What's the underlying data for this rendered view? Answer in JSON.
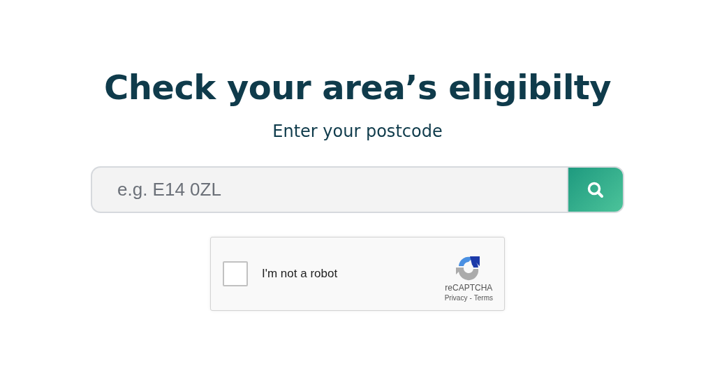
{
  "heading": "Check your area’s eligibilty",
  "subheading": "Enter your postcode",
  "search": {
    "placeholder": "e.g. E14 0ZL"
  },
  "captcha": {
    "label": "I'm not a robot",
    "checked": false,
    "brand": "reCAPTCHA",
    "links": [
      "Privacy",
      "Terms"
    ],
    "separator": "-"
  }
}
